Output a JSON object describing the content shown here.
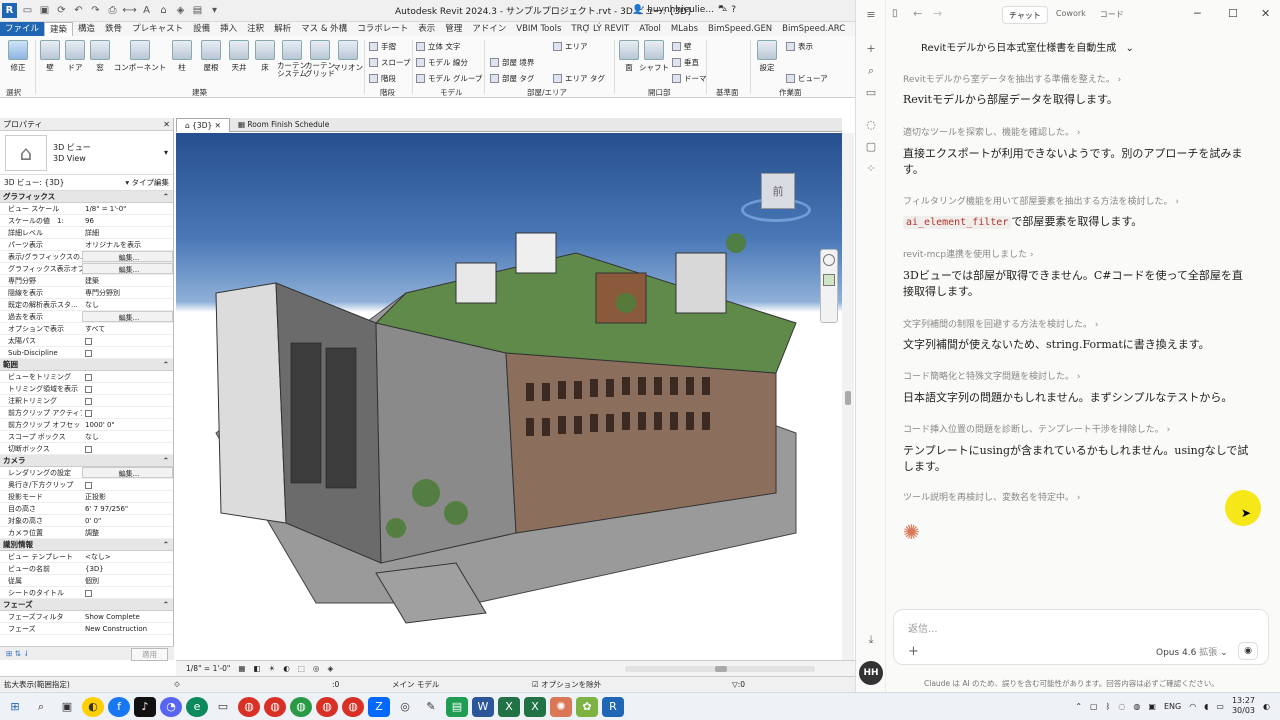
{
  "revit": {
    "title": "Autodesk Revit 2024.3 - サンプルプロジェクト.rvt - 3D ビュー: {3D}",
    "user": "huynhhieulie...",
    "menu_tabs": [
      "ファイル",
      "建築",
      "構造",
      "鉄骨",
      "プレキャスト",
      "設備",
      "挿入",
      "注釈",
      "解析",
      "マス & 外構",
      "コラボレート",
      "表示",
      "管理",
      "アドイン",
      "VBIM Tools",
      "TRỢ LÝ REVIT",
      "ATool",
      "MLabs",
      "BimSpeed.GEN",
      "BimSpeed.ARC"
    ],
    "ribbon": {
      "modify": "修正",
      "select": "選択",
      "wall": "壁",
      "door": "ドア",
      "window": "窓",
      "component": "コンポーネント",
      "column": "柱",
      "roof": "屋根",
      "ceiling": "天井",
      "floor": "床",
      "curtain_system": "カーテン\nシステム",
      "curtain_grid": "カーテン\nグリッド",
      "mullion": "マリオン",
      "railing": "手摺",
      "ramp": "スロープ",
      "stair": "階段",
      "model_text": "立体 文字",
      "model_line": "モデル 線分",
      "model_group": "モデル グループ",
      "room": "部屋",
      "room_separator": "部屋 境界",
      "tag_room": "部屋 タグ",
      "area": "エリア",
      "area_boundary": "エリア 境界",
      "tag_area": "エリア タグ",
      "shaft": "シャフト",
      "opening_face": "面",
      "wall_open": "壁",
      "vertical": "垂直",
      "dormer": "ドーマ",
      "set": "設定",
      "show": "表示",
      "ref_plane": "参照面",
      "viewer": "ビューア",
      "panels": [
        "建築",
        "階段",
        "モデル",
        "部屋/エリア",
        "開口部",
        "基準面",
        "作業面"
      ]
    },
    "properties": {
      "header": "プロパティ",
      "type_name": "3D ビュー",
      "type_sub": "3D View",
      "view_selector": "3D ビュー: {3D}",
      "edit_type": "タイプ編集",
      "groups": [
        {
          "name": "グラフィックス",
          "rows": [
            [
              "ビュー スケール",
              "1/8\" = 1'-0\""
            ],
            [
              "スケールの値　1:",
              "96"
            ],
            [
              "詳細レベル",
              "詳細"
            ],
            [
              "パーツ表示",
              "オリジナルを表示"
            ],
            [
              "表示/グラフィックスの...",
              "編集..."
            ],
            [
              "グラフィックス表示オプ...",
              "編集..."
            ],
            [
              "専門分野",
              "建築"
            ],
            [
              "隠線を表示",
              "専門分野別"
            ],
            [
              "既定の解析表示スタ...",
              "なし"
            ],
            [
              "過去を表示",
              "編集..."
            ],
            [
              "オプションで表示",
              "すべて"
            ],
            [
              "太陽パス",
              ""
            ],
            [
              "Sub-Discipline",
              ""
            ]
          ]
        },
        {
          "name": "範囲",
          "rows": [
            [
              "ビューをトリミング",
              ""
            ],
            [
              "トリミング領域を表示",
              ""
            ],
            [
              "注釈トリミング",
              ""
            ],
            [
              "前方クリップ アクティブ",
              ""
            ],
            [
              "前方クリップ オフセット",
              "1000'  0\""
            ],
            [
              "スコープ ボックス",
              "なし"
            ],
            [
              "切断ボックス",
              ""
            ]
          ]
        },
        {
          "name": "カメラ",
          "rows": [
            [
              "レンダリングの設定",
              "編集..."
            ],
            [
              "奥行き/下方クリップ",
              ""
            ],
            [
              "投影モード",
              "正投影"
            ],
            [
              "目の高さ",
              "6'  7 97/256\""
            ],
            [
              "対象の高さ",
              "0'  0\""
            ],
            [
              "カメラ位置",
              "調整"
            ]
          ]
        },
        {
          "name": "識別情報",
          "rows": [
            [
              "ビュー テンプレート",
              "<なし>"
            ],
            [
              "ビューの名前",
              "{3D}"
            ],
            [
              "従属",
              "個別"
            ],
            [
              "シートのタイトル",
              ""
            ]
          ]
        },
        {
          "name": "フェーズ",
          "rows": [
            [
              "フェーズフィルタ",
              "Show Complete"
            ],
            [
              "フェーズ",
              "New Construction"
            ]
          ]
        }
      ],
      "apply": "適用"
    },
    "view_tabs": [
      "{3D}",
      "Room Finish Schedule"
    ],
    "viewcube_label": "前",
    "view_scale": "1/8\" = 1'-0\"",
    "status_left": "拡大表示(範囲指定)",
    "status_zero": ":0",
    "status_model": "メイン モデル",
    "status_option": "オプションを除外",
    "status_zero2": ":0"
  },
  "claude": {
    "modes": [
      "チャット",
      "Cowork",
      "コード"
    ],
    "conversation_title": "Revitモデルから日本式室仕様書を自動生成",
    "items": [
      {
        "step": "Revitモデルから室データを抽出する準備を整えた。",
        "msg": "Revitモデルから部屋データを取得します。"
      },
      {
        "step": "適切なツールを探索し、機能を確認した。",
        "msg": "直接エクスポートが利用できないようです。別のアプローチを試みます。"
      },
      {
        "step": "フィルタリング機能を用いて部屋要素を抽出する方法を検討した。",
        "msg_code": "ai_element_filter",
        "msg": "で部屋要素を取得します。"
      },
      {
        "step": "revit-mcp連携を使用しました",
        "msg": "3Dビューでは部屋が取得できません。C#コードを使って全部屋を直接取得します。"
      },
      {
        "step": "文字列補間の制限を回避する方法を検討した。",
        "msg": "文字列補間が使えないため、string.Formatに書き換えます。"
      },
      {
        "step": "コード簡略化と特殊文字問題を検討した。",
        "msg": "日本語文字列の問題かもしれません。まずシンプルなテストから。"
      },
      {
        "step": "コード挿入位置の問題を診断し、テンプレート干渉を排除した。",
        "msg": "テンプレートにusingが含まれているかもしれません。usingなしで試します。"
      },
      {
        "step": "ツール説明を再検討し、変数名を特定中。",
        "msg": ""
      }
    ],
    "input_placeholder": "返信...",
    "model": "Opus 4.6",
    "model_mode": "拡張",
    "disclaimer": "Claude は AI のため、誤りを含む可能性があります。回答内容は必ずご確認ください。",
    "avatar": "HH"
  },
  "taskbar": {
    "lang": "ENG",
    "time": "13:27",
    "date": "30/03"
  },
  "colors": {
    "revit_blue": "#1f66b5",
    "claude_accent": "#d97757",
    "cursor_highlight": "#f5e400"
  }
}
